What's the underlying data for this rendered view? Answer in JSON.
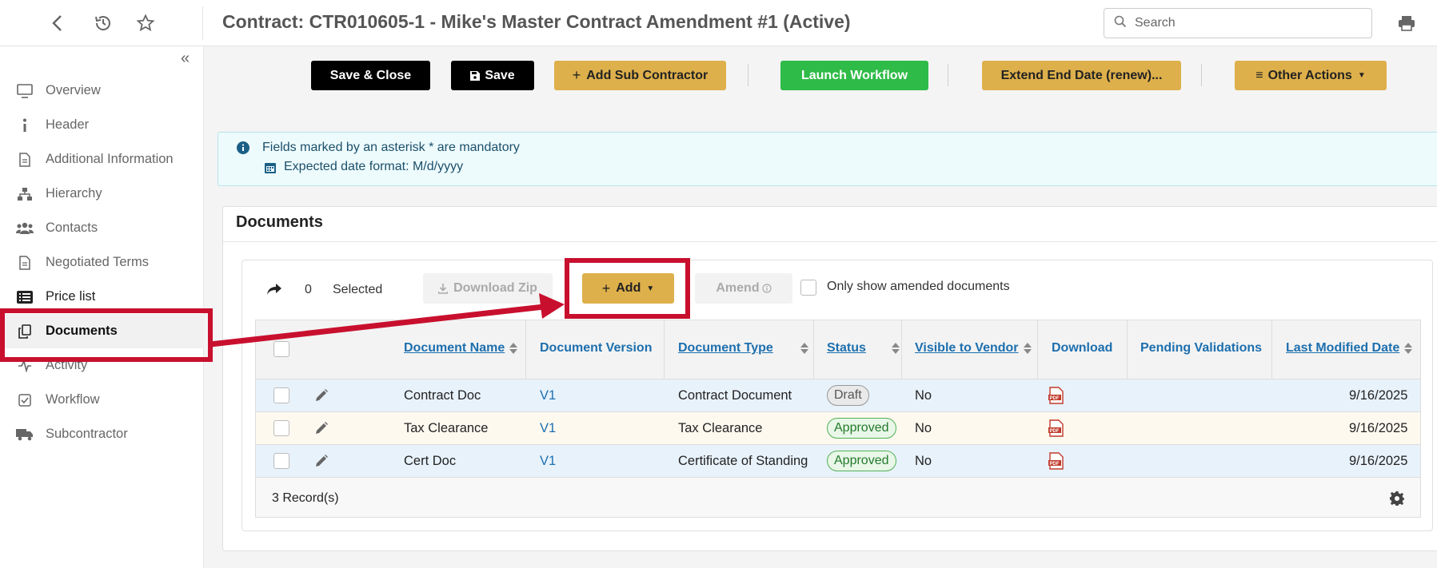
{
  "header": {
    "title": "Contract: CTR010605-1 - Mike's Master Contract Amendment #1 (Active)",
    "search_placeholder": "Search"
  },
  "sidebar": {
    "items": [
      {
        "label": "Overview",
        "icon": "monitor-icon"
      },
      {
        "label": "Header",
        "icon": "info-icon"
      },
      {
        "label": "Additional Information",
        "icon": "document-icon"
      },
      {
        "label": "Hierarchy",
        "icon": "hierarchy-icon"
      },
      {
        "label": "Contacts",
        "icon": "users-icon"
      },
      {
        "label": "Negotiated Terms",
        "icon": "document-icon"
      },
      {
        "label": "Price list",
        "icon": "list-icon"
      },
      {
        "label": "Documents",
        "icon": "copy-icon"
      },
      {
        "label": "Activity",
        "icon": "activity-icon"
      },
      {
        "label": "Workflow",
        "icon": "check-square-icon"
      },
      {
        "label": "Subcontractor",
        "icon": "truck-icon"
      }
    ],
    "active": "Documents"
  },
  "toolbar": {
    "save_close": "Save & Close",
    "save": "Save",
    "add_sub": "Add Sub Contractor",
    "launch_workflow": "Launch Workflow",
    "extend": "Extend End Date (renew)...",
    "other_actions": "Other Actions"
  },
  "info": {
    "line1": "Fields marked by an asterisk * are mandatory",
    "line2": "Expected date format: M/d/yyyy"
  },
  "documents": {
    "title": "Documents",
    "selected_count": "0",
    "selected_label": "Selected",
    "download_zip": "Download Zip",
    "add": "Add",
    "amend": "Amend",
    "only_amended": "Only show amended documents",
    "columns": [
      "Document Name",
      "Document Version",
      "Document Type",
      "Status",
      "Visible to Vendor",
      "Download",
      "Pending Validations",
      "Last Modified Date"
    ],
    "rows": [
      {
        "name": "Contract Doc",
        "version": "V1",
        "type": "Contract Document",
        "status": "Draft",
        "visible": "No",
        "date": "9/16/2025"
      },
      {
        "name": "Tax Clearance",
        "version": "V1",
        "type": "Tax Clearance",
        "status": "Approved",
        "visible": "No",
        "date": "9/16/2025"
      },
      {
        "name": "Cert Doc",
        "version": "V1",
        "type": "Certificate of Standing",
        "status": "Approved",
        "visible": "No",
        "date": "9/16/2025"
      }
    ],
    "records": "3 Record(s)"
  },
  "colors": {
    "accent_gold": "#deb04b",
    "green": "#2fbb47",
    "link_blue": "#1d6fae",
    "highlight_red": "#c8102e",
    "row_blue": "#e8f2fb",
    "row_cream": "#fdf9ef"
  }
}
